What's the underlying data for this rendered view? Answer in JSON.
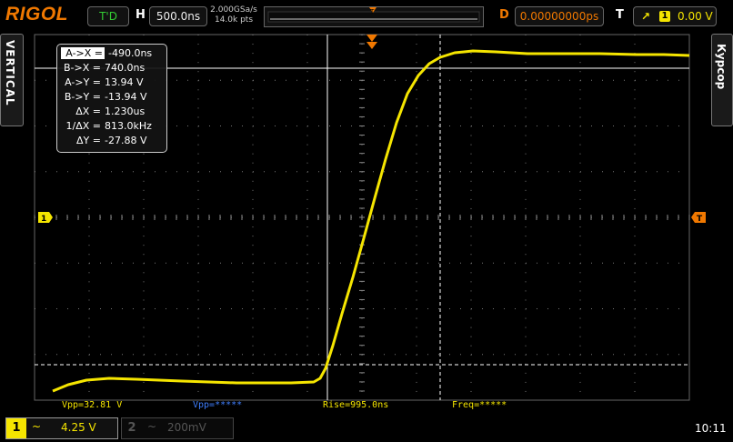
{
  "brand": "RIGOL",
  "run_status": "T'D",
  "horizontal": {
    "label": "H",
    "timebase": "500.0ns",
    "sample_rate": "2.000GSa/s",
    "memory_depth": "14.0k pts"
  },
  "delay": {
    "label": "D",
    "value": "0.00000000ps"
  },
  "trigger": {
    "label": "T",
    "channel": "1",
    "level": "0.00 V"
  },
  "side_tabs": {
    "left": "VERTICAL",
    "right": "Курсор"
  },
  "channel1_marker": "1",
  "cursor_readout": {
    "rows": [
      {
        "label": "A->X =",
        "value": "-490.0ns",
        "selected": true
      },
      {
        "label": "B->X =",
        "value": "740.0ns"
      },
      {
        "label": "A->Y =",
        "value": "13.94 V"
      },
      {
        "label": "B->Y =",
        "value": "-13.94 V"
      },
      {
        "label": "ΔX =",
        "value": "1.230us"
      },
      {
        "label": "1/ΔX =",
        "value": "813.0kHz"
      },
      {
        "label": "ΔY =",
        "value": "-27.88 V"
      }
    ]
  },
  "measurements": {
    "vpp1": "Vpp=32.81 V",
    "vpp2": "Vpp=*****",
    "rise": "Rise=995.0ns",
    "freq": "Freq=*****"
  },
  "ch1": {
    "number": "1",
    "coupling": "~",
    "scale": "4.25 V"
  },
  "ch2": {
    "number": "2",
    "coupling": "~",
    "scale": "200mV"
  },
  "clock": "10:11",
  "colors": {
    "ch1": "#f5e500",
    "accent": "#f07800",
    "grid": "#555555",
    "cursor": "#ffffff"
  }
}
